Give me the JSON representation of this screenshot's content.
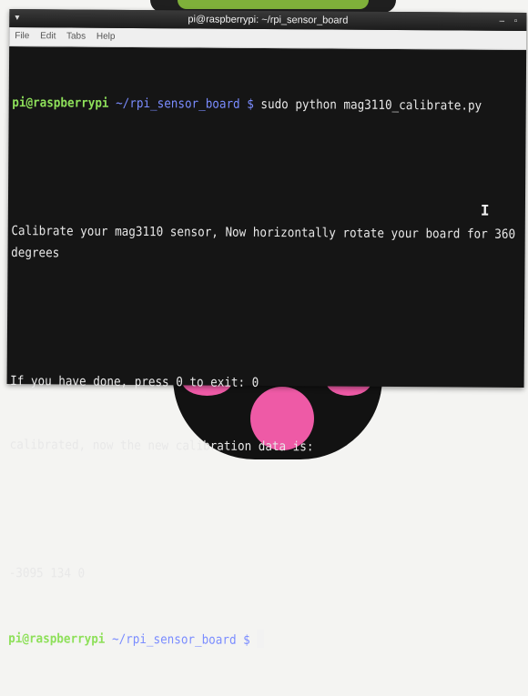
{
  "window": {
    "title": "pi@raspberrypi: ~/rpi_sensor_board",
    "controls": "– ▫"
  },
  "menu": {
    "items": [
      "File",
      "Edit",
      "Tabs",
      "Help"
    ]
  },
  "terminal": {
    "prompt_user": "pi@raspberrypi",
    "prompt_path": " ~/rpi_sensor_board $ ",
    "command": "sudo python mag3110_calibrate.py",
    "output_line_1": "Calibrate your mag3110 sensor, Now horizontally rotate your board for 360 degrees",
    "output_line_2": "If you have done, press 0 to exit: 0",
    "output_line_3": "calibrated, now the new calibration data is:",
    "output_line_4": "-3095 134 0",
    "prompt2_user": "pi@raspberrypi",
    "prompt2_path": " ~/rpi_sensor_board $ "
  },
  "colors": {
    "terminal_bg": "#151515",
    "prompt_user": "#8ee05a",
    "prompt_path": "#7a8cff",
    "accent_pads": "#ee5aa6"
  },
  "icons": [
    "terminal-icon",
    "text-cursor-icon",
    "block-cursor"
  ]
}
